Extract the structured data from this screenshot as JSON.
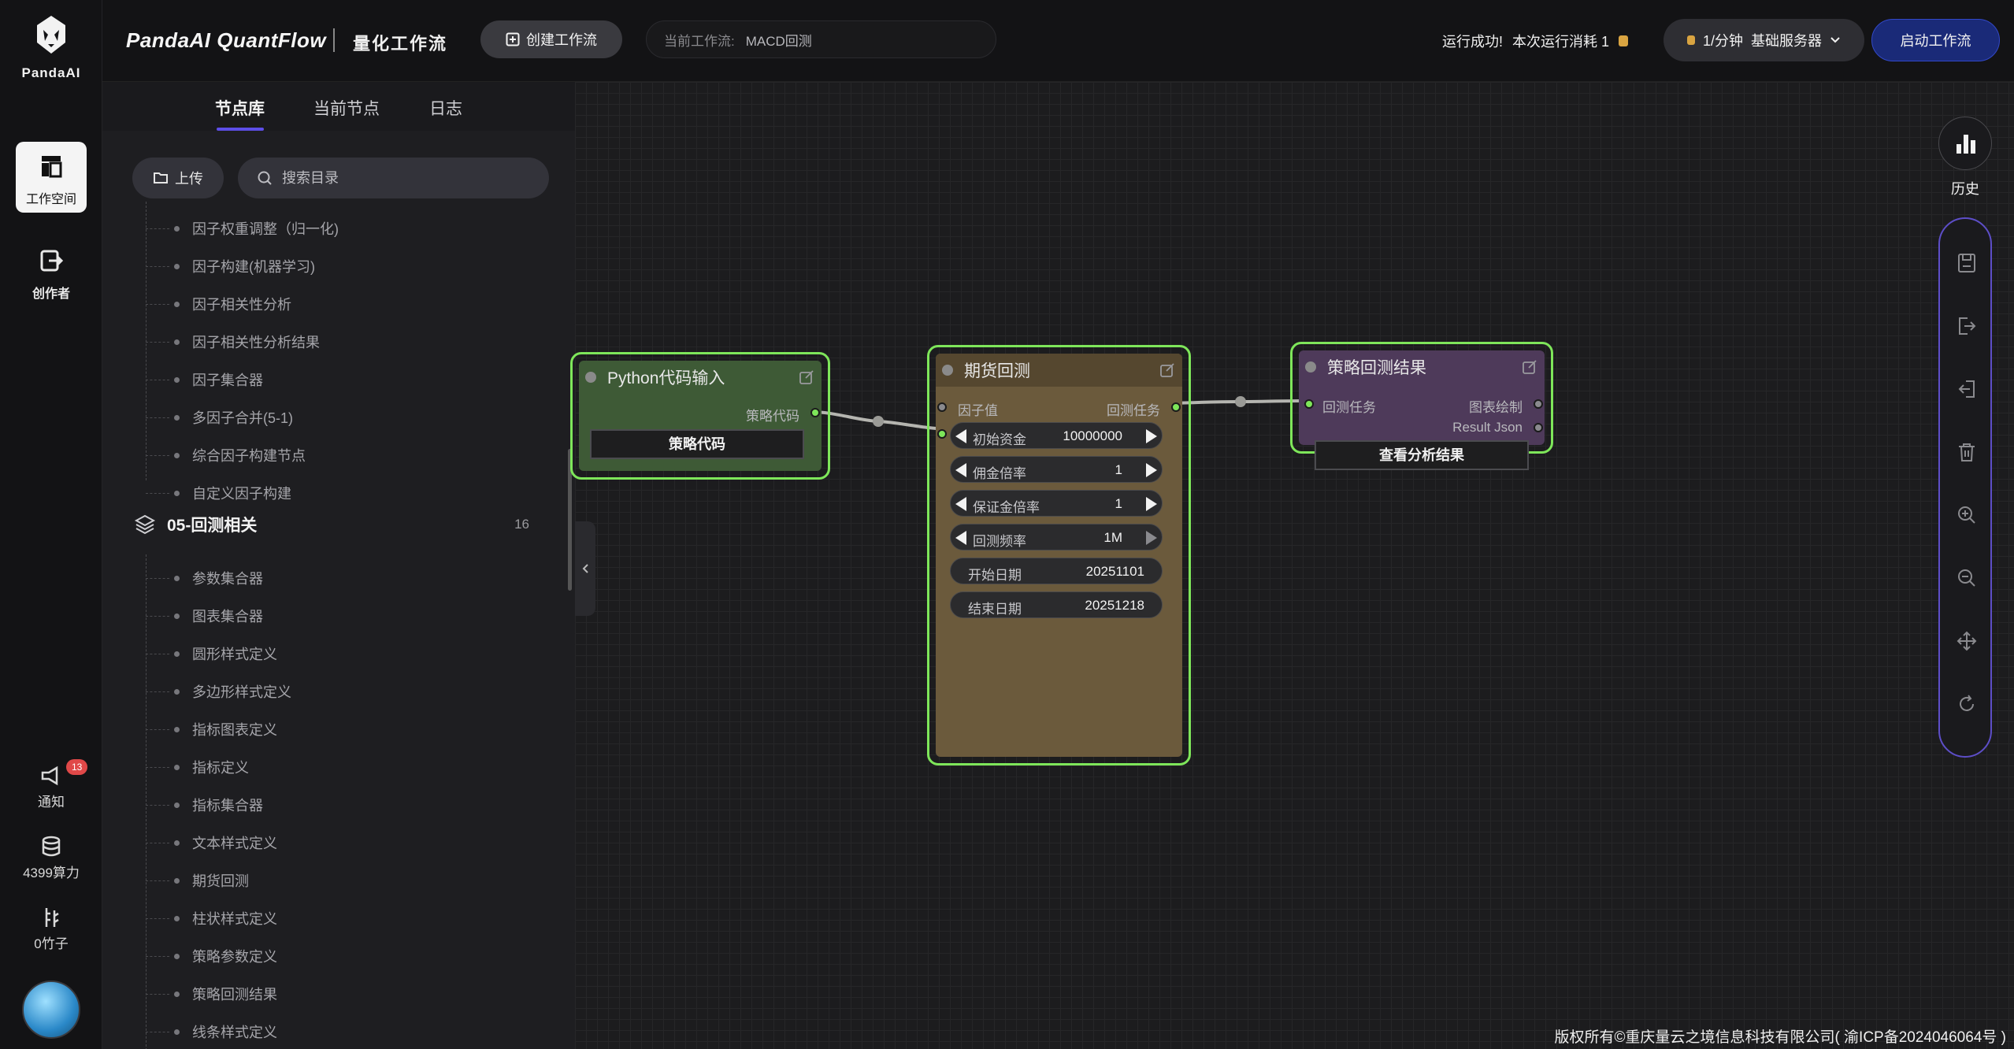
{
  "brand": {
    "name": "PandaAI"
  },
  "rail": {
    "workspace_label": "工作空间",
    "creator_label": "创作者",
    "notify_label": "通知",
    "notify_count": "13",
    "compute_label": "4399算力",
    "bamboo_label": "0竹子"
  },
  "header": {
    "title": "PandaAI QuantFlow",
    "subtitle": "量化工作流",
    "create_label": "创建工作流",
    "current_label": "当前工作流:",
    "current_value": "MACD回测",
    "run_status": "运行成功!",
    "run_cost": "本次运行消耗 1",
    "server_rate": "1/分钟",
    "server_name": "基础服务器",
    "start_label": "启动工作流"
  },
  "panel": {
    "tabs": [
      "节点库",
      "当前节点",
      "日志"
    ],
    "upload_label": "上传",
    "search_placeholder": "搜索目录",
    "items_top": [
      "因子权重调整（归一化)",
      "因子构建(机器学习)",
      "因子相关性分析",
      "因子相关性分析结果",
      "因子集合器",
      "多因子合并(5-1)",
      "综合因子构建节点",
      "自定义因子构建"
    ],
    "group": {
      "name": "05-回测相关",
      "count": "16"
    },
    "items_group": [
      "参数集合器",
      "图表集合器",
      "圆形样式定义",
      "多边形样式定义",
      "指标图表定义",
      "指标定义",
      "指标集合器",
      "文本样式定义",
      "期货回测",
      "柱状样式定义",
      "策略参数定义",
      "策略回测结果",
      "线条样式定义"
    ]
  },
  "nodes": {
    "python": {
      "title": "Python代码输入",
      "output": "策略代码",
      "button": "策略代码"
    },
    "futures": {
      "title": "期货回测",
      "input": "因子值",
      "output": "回测任务",
      "widgets": [
        {
          "label": "初始资金",
          "value": "10000000"
        },
        {
          "label": "佣金倍率",
          "value": "1"
        },
        {
          "label": "保证金倍率",
          "value": "1"
        },
        {
          "label": "回测频率",
          "value": "1M"
        },
        {
          "label": "开始日期",
          "value": "20251101"
        },
        {
          "label": "结束日期",
          "value": "20251218"
        }
      ]
    },
    "result": {
      "title": "策略回测结果",
      "input": "回测任务",
      "output1": "图表绘制",
      "output2": "Result Json",
      "button": "查看分析结果"
    }
  },
  "right": {
    "history_label": "历史"
  },
  "footer": "版权所有©重庆量云之境信息科技有限公司( 渝ICP备2024046064号 )",
  "colors": {
    "accent": "#5d4ee8",
    "node_border": "#7ee65a",
    "python_bg": "#3e5a36",
    "futures_bg": "#6b5a3c",
    "result_bg": "#4e3a5a"
  }
}
